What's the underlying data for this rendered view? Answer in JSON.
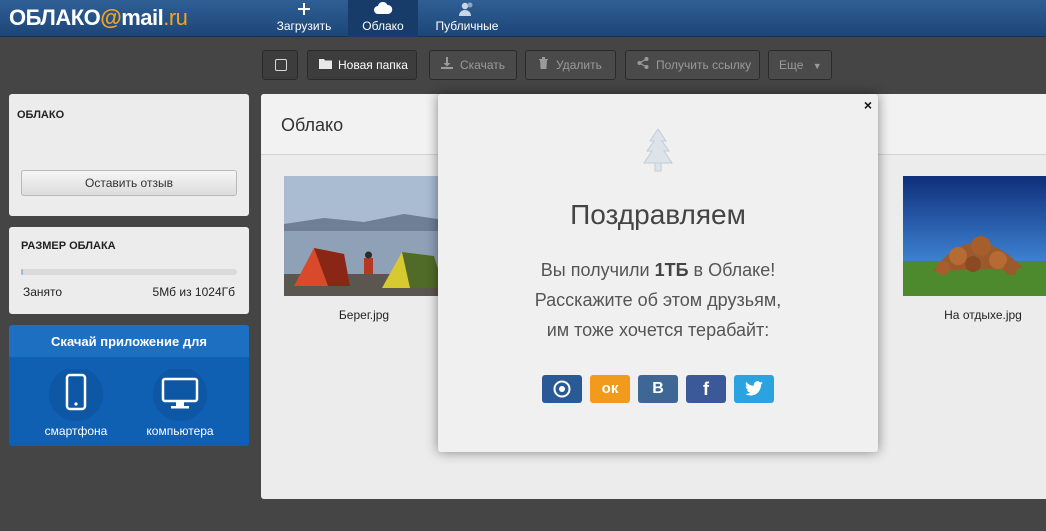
{
  "logo": {
    "part1": "ОБЛАКО",
    "at": "@",
    "part2": "mail",
    "dot_ru": ".ru"
  },
  "nav": [
    {
      "label": "Загрузить",
      "icon": "plus-icon"
    },
    {
      "label": "Облако",
      "icon": "cloud-icon"
    },
    {
      "label": "Публичные",
      "icon": "users-icon"
    }
  ],
  "toolbar": {
    "new_folder": "Новая папка",
    "download": "Скачать",
    "delete": "Удалить",
    "get_link": "Получить ссылку",
    "more": "Еще"
  },
  "sidebar": {
    "cloud_title": "ОБЛАКО",
    "feedback": "Оставить отзыв",
    "size_title": "РАЗМЕР ОБЛАКА",
    "used_label": "Занято",
    "used_value": "5Мб из 1024Гб",
    "used_fraction": 0.005,
    "app_title": "Скачай приложение для",
    "app_phone": "смартфона",
    "app_computer": "компьютера"
  },
  "main": {
    "title": "Облако",
    "files": [
      "Берег.jpg",
      "На отдыхе.jpg"
    ]
  },
  "modal": {
    "close": "×",
    "title": "Поздравляем",
    "line1_a": "Вы получили ",
    "line1_b": "1ТБ",
    "line1_c": " в Облаке!",
    "line2": "Расскажите об этом друзьям,",
    "line3": "им тоже хочется терабайт:",
    "share_ok": "ок",
    "share_vk": "В",
    "share_fb": "f"
  },
  "colors": {
    "topbar": "#1d4678",
    "accent": "#f7a21b",
    "mailru_share": "#2a5a96",
    "ok_share": "#f29a1b",
    "vk_share": "#3f6796",
    "fb_share": "#3b5998",
    "tw_share": "#2aa3e0"
  }
}
